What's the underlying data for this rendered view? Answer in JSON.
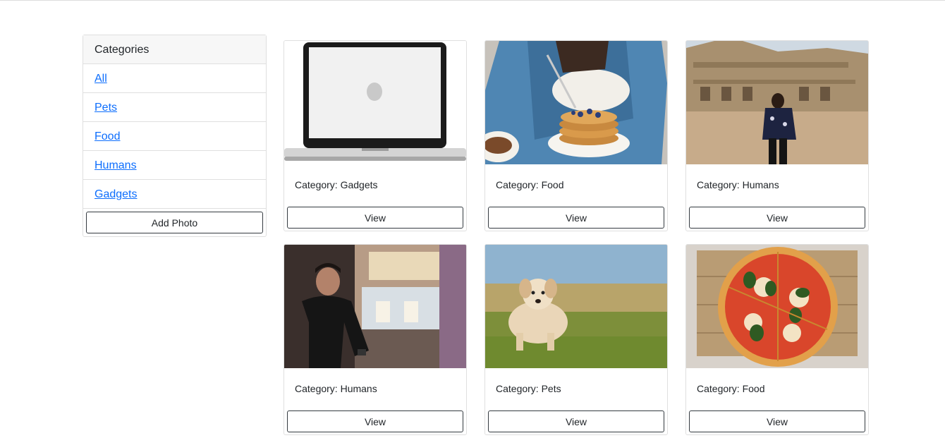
{
  "sidebar": {
    "header": "Categories",
    "items": [
      {
        "label": "All"
      },
      {
        "label": "Pets"
      },
      {
        "label": "Food"
      },
      {
        "label": "Humans"
      },
      {
        "label": "Gadgets"
      }
    ],
    "add_photo_label": "Add Photo"
  },
  "cards": [
    {
      "category": "Category: Gadgets",
      "view_label": "View",
      "image": "laptop-photo"
    },
    {
      "category": "Category: Food",
      "view_label": "View",
      "image": "pancakes-photo"
    },
    {
      "category": "Category: Humans",
      "view_label": "View",
      "image": "woman-at-fort-photo"
    },
    {
      "category": "Category: Humans",
      "view_label": "View",
      "image": "man-at-restaurant-photo"
    },
    {
      "category": "Category: Pets",
      "view_label": "View",
      "image": "puppy-photo"
    },
    {
      "category": "Category: Food",
      "view_label": "View",
      "image": "pizza-photo"
    }
  ],
  "colors": {
    "link": "#0d6efd",
    "border": "#dfdfdf",
    "button_border": "#343a40"
  }
}
